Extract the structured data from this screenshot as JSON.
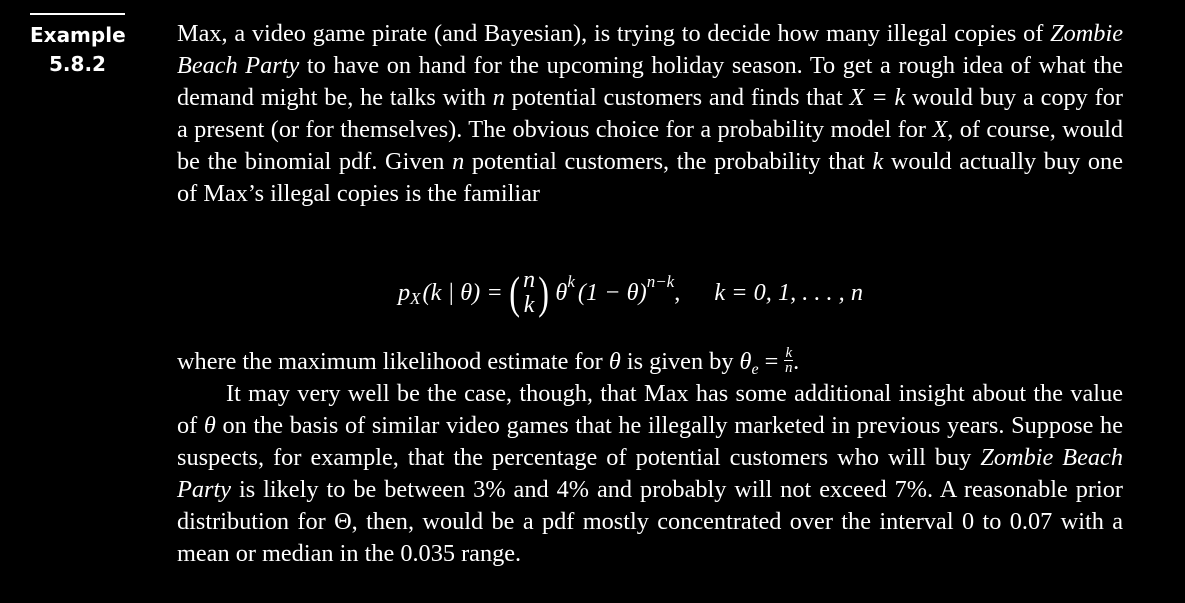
{
  "example": {
    "label": "Example",
    "number": "5.8.2"
  },
  "para1": {
    "s1": "Max, a video game pirate (and Bayesian), is trying to decide how many illegal copies of ",
    "title1": "Zombie Beach Party",
    "s2": " to have on hand for the upcoming holiday season. To get a rough idea of what the demand might be, he talks with ",
    "n1": "n",
    "s3": " potential customers and finds that ",
    "xk": "X = k",
    "s4": " would buy a copy for a present (or for themselves). The obvious choice for a probability model for ",
    "x2": "X",
    "s5": ", of course, would be the binomial pdf. Given ",
    "n2": "n",
    "s6": " potential customers, the probability that ",
    "k1": "k",
    "s7": " would actually buy one of Max’s illegal copies is the familiar"
  },
  "equation": {
    "p": "p",
    "sub": "X",
    "args": "(k | θ) =",
    "binom_top": "n",
    "binom_bottom": "k",
    "theta": "θ",
    "exp1": "k",
    "mid": "(1 − θ)",
    "exp2": "n−k",
    "comma": ",",
    "range": "k = 0, 1, . . . , n"
  },
  "para2": {
    "s1": "where the maximum likelihood estimate for ",
    "theta": "θ",
    "s2": " is given by ",
    "theta_e": "θ",
    "sub_e": "e",
    "eq": " = ",
    "num": "k",
    "den": "n",
    "end": "."
  },
  "para3": {
    "s1": "It may very well be the case, though, that Max has some additional insight about the value of ",
    "theta": "θ",
    "s2": " on the basis of similar video games that he illegally marketed in previous years. Suppose he suspects, for example, that the percentage of potential customers who will buy ",
    "title2": "Zombie Beach Party",
    "s3": " is likely to be between 3% and 4% and probably will not exceed 7%. A reasonable prior distribution for Θ, then, would be a pdf mostly concentrated over the interval 0 to 0.07 with a mean or median in the 0.035 range."
  }
}
